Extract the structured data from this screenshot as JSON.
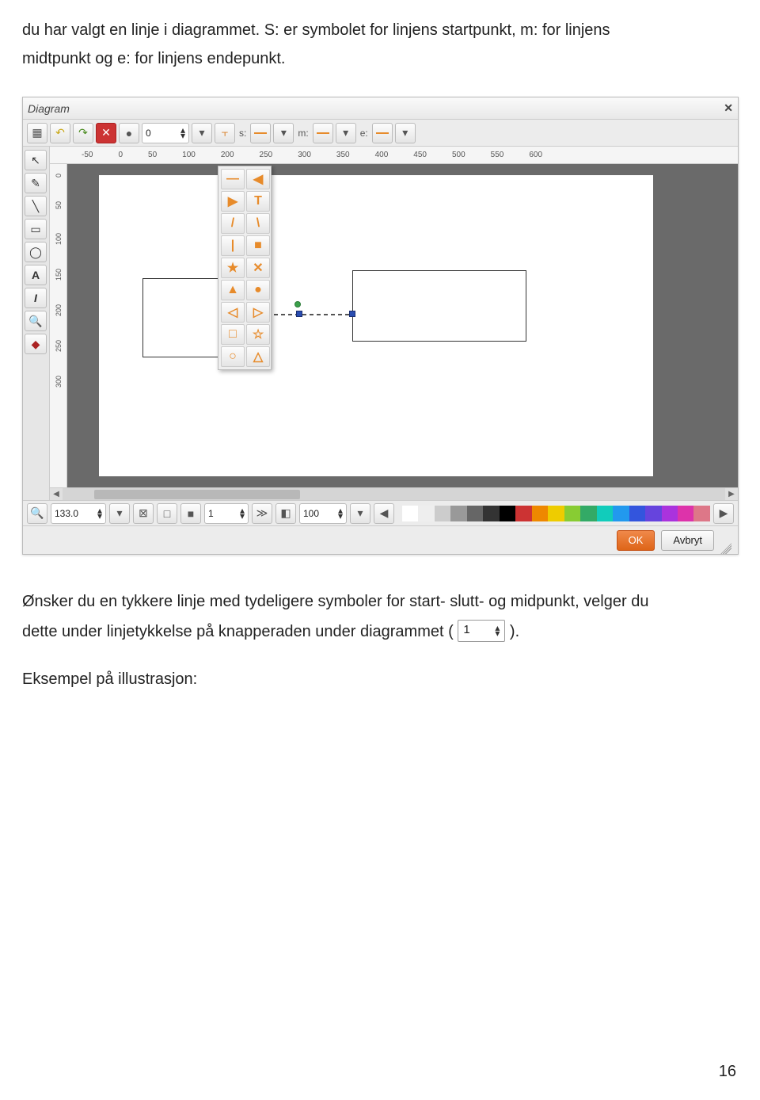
{
  "intro": {
    "line1": "du har valgt en linje i diagrammet. S: er symbolet for linjens startpunkt, m: for linjens",
    "line2": "midtpunkt og e: for linjens endepunkt."
  },
  "editor": {
    "title": "Diagram",
    "top_toolbar": {
      "spin_value": "0",
      "label_s": "s:",
      "label_m": "m:",
      "label_e": "e:"
    },
    "left_tools": {
      "pointer": "↖",
      "pen": "✎",
      "line": "╲",
      "rect": "▭",
      "ellipse": "◯",
      "text_a": "A",
      "text_i": "I",
      "zoom": "🔍",
      "diamond": "◆"
    },
    "hruler_ticks": [
      "-50",
      "0",
      "50",
      "100",
      "200",
      "250",
      "300",
      "350",
      "400",
      "450",
      "500",
      "550",
      "600"
    ],
    "vruler_ticks": [
      "0",
      "50",
      "100",
      "150",
      "200",
      "250",
      "300"
    ],
    "symbol_glyphs": [
      "—",
      "◀",
      "▶",
      "T",
      "/",
      "\\",
      "|",
      "■",
      "★",
      "✕",
      "▲",
      "●",
      "◁",
      "▷",
      "□",
      "☆",
      "○",
      "△"
    ],
    "bottom_bar": {
      "zoom_value": "133.0",
      "spin1": "1",
      "spin2": "100"
    },
    "colors": [
      "#fff",
      "#eee",
      "#ccc",
      "#999",
      "#666",
      "#333",
      "#000",
      "#c33",
      "#e80",
      "#ec0",
      "#8c3",
      "#3a6",
      "#1cb",
      "#29e",
      "#35d",
      "#64d",
      "#a3d",
      "#d3a",
      "#d78"
    ],
    "footer": {
      "ok": "OK",
      "cancel": "Avbryt"
    }
  },
  "post": {
    "p1a": "Ønsker du en tykkere linje med tydeligere symboler for start- slutt- og midpunkt, velger du",
    "p1b_prefix": "dette under linjetykkelse på knapperaden under diagrammet (",
    "p1b_suffix": ").",
    "widget_value": "1",
    "p2": "Eksempel på illustrasjon:"
  },
  "page_number": "16"
}
